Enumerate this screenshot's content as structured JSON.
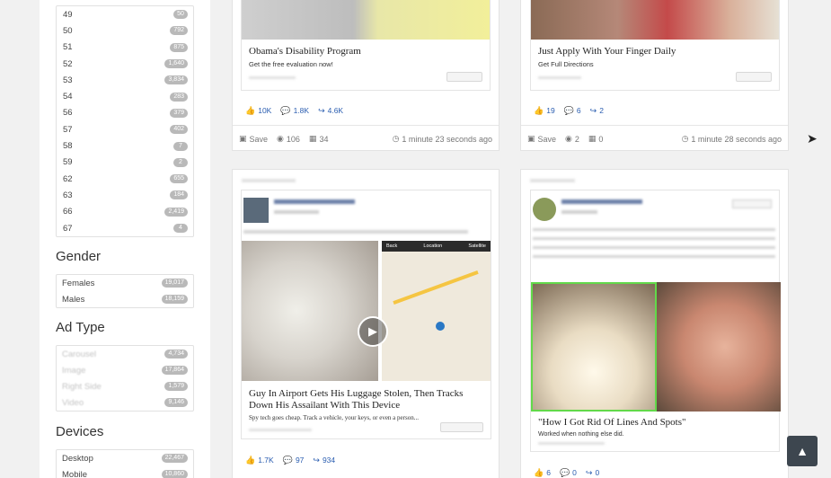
{
  "sidebar": {
    "ages": [
      {
        "label": "49",
        "count": "50"
      },
      {
        "label": "50",
        "count": "792"
      },
      {
        "label": "51",
        "count": "875"
      },
      {
        "label": "52",
        "count": "1,640"
      },
      {
        "label": "53",
        "count": "3,834"
      },
      {
        "label": "54",
        "count": "283"
      },
      {
        "label": "56",
        "count": "379"
      },
      {
        "label": "57",
        "count": "402"
      },
      {
        "label": "58",
        "count": "7"
      },
      {
        "label": "59",
        "count": "2"
      },
      {
        "label": "62",
        "count": "655"
      },
      {
        "label": "63",
        "count": "184"
      },
      {
        "label": "66",
        "count": "2,419"
      },
      {
        "label": "67",
        "count": "4"
      }
    ],
    "gender_title": "Gender",
    "gender": [
      {
        "label": "Females",
        "count": "19,017"
      },
      {
        "label": "Males",
        "count": "18,159"
      }
    ],
    "adtype_title": "Ad Type",
    "adtype": [
      {
        "label": "Carousel",
        "count": "4,734"
      },
      {
        "label": "Image",
        "count": "17,864"
      },
      {
        "label": "Right Side",
        "count": "1,579"
      },
      {
        "label": "Video",
        "count": "9,146"
      }
    ],
    "devices_title": "Devices",
    "devices": [
      {
        "label": "Desktop",
        "count": "22,467"
      },
      {
        "label": "Mobile",
        "count": "10,860"
      }
    ]
  },
  "cards": {
    "c1": {
      "title": "Obama's Disability Program",
      "subtitle": "Get the free evaluation now!",
      "likes": "10K",
      "comments": "1.8K",
      "shares": "4.6K",
      "save": "Save",
      "views": "106",
      "date_count": "34",
      "time": "1 minute 23 seconds ago"
    },
    "c2": {
      "title": "Just Apply With Your Finger Daily",
      "subtitle": "Get Full Directions",
      "likes": "19",
      "comments": "6",
      "shares": "2",
      "save": "Save",
      "views": "2",
      "date_count": "0",
      "time": "1 minute 28 seconds ago"
    },
    "c3": {
      "title": "Guy In Airport Gets His Luggage Stolen, Then Tracks Down His Assailant With This Device",
      "subtitle": "Spy tech goes cheap. Track a vehicle, your keys, or even a person...",
      "likes": "1.7K",
      "comments": "97",
      "shares": "934",
      "map_labels": [
        "Back",
        "Location",
        "Satellite"
      ]
    },
    "c4": {
      "title": "\"How I Got Rid Of Lines And Spots\"",
      "subtitle": "Worked when nothing else did.",
      "likes": "6",
      "comments": "0",
      "shares": "0"
    }
  },
  "colors": {
    "accent": "#2a5db0",
    "scroll_top_bg": "#3d464f"
  }
}
